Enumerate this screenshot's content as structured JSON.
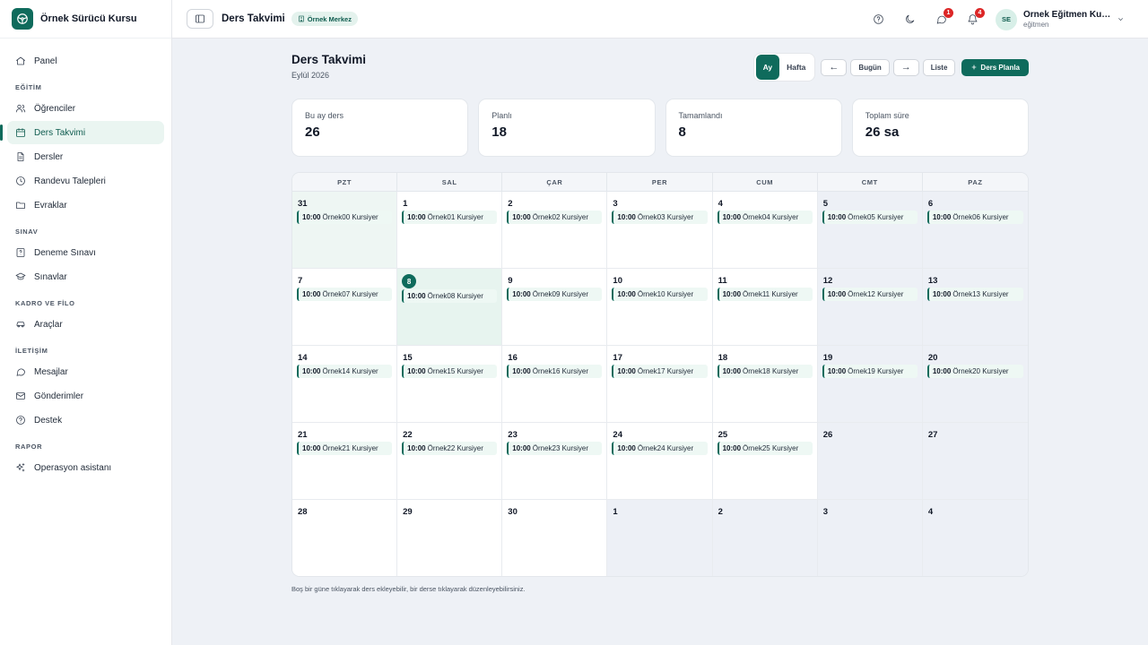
{
  "app": {
    "name": "Örnek Sürücü Kursu"
  },
  "sidebar": {
    "top_item": {
      "label": "Panel",
      "icon": "home-icon"
    },
    "sections": [
      {
        "title": "EĞİTİM",
        "items": [
          {
            "label": "Öğrenciler",
            "icon": "users-icon",
            "active": false
          },
          {
            "label": "Ders Takvimi",
            "icon": "calendar-icon",
            "active": true
          },
          {
            "label": "Dersler",
            "icon": "document-icon",
            "active": false
          },
          {
            "label": "Randevu Talepleri",
            "icon": "clock-icon",
            "active": false
          },
          {
            "label": "Evraklar",
            "icon": "folder-icon",
            "active": false
          }
        ]
      },
      {
        "title": "SINAV",
        "items": [
          {
            "label": "Deneme Sınavı",
            "icon": "quiz-icon",
            "active": false
          },
          {
            "label": "Sınavlar",
            "icon": "graduation-cap-icon",
            "active": false
          }
        ]
      },
      {
        "title": "KADRO VE FİLO",
        "items": [
          {
            "label": "Araçlar",
            "icon": "car-icon",
            "active": false
          }
        ]
      },
      {
        "title": "İLETİŞİM",
        "items": [
          {
            "label": "Mesajlar",
            "icon": "message-icon",
            "active": false
          },
          {
            "label": "Gönderimler",
            "icon": "mail-icon",
            "active": false
          },
          {
            "label": "Destek",
            "icon": "help-icon",
            "active": false
          }
        ]
      },
      {
        "title": "RAPOR",
        "items": [
          {
            "label": "Operasyon asistanı",
            "icon": "sparkles-icon",
            "active": false
          }
        ]
      }
    ]
  },
  "topbar": {
    "title": "Ders Takvimi",
    "branch": "Örnek Merkez",
    "message_badge": "1",
    "notification_badge": "4",
    "user": {
      "initials": "SE",
      "name": "Örnek Eğitmen Kullanıcı",
      "role": "eğitmen"
    }
  },
  "page": {
    "title": "Ders Takvimi",
    "subtitle": "Eylül 2026",
    "view_month": "Ay",
    "view_week": "Hafta",
    "prev": "←",
    "today": "Bugün",
    "next": "→",
    "list": "Liste",
    "add_lesson": "Ders Planla"
  },
  "stats": [
    {
      "label": "Bu ay ders",
      "value": "26"
    },
    {
      "label": "Planlı",
      "value": "18"
    },
    {
      "label": "Tamamlandı",
      "value": "8"
    },
    {
      "label": "Toplam süre",
      "value": "26 sa"
    }
  ],
  "calendar": {
    "weekdays": [
      "PZT",
      "SAL",
      "ÇAR",
      "PER",
      "CUM",
      "CMT",
      "PAZ"
    ],
    "days": [
      {
        "num": "31",
        "outside": true,
        "event": {
          "time": "10:00",
          "text": "Örnek00 Kursiyer"
        }
      },
      {
        "num": "1",
        "event": {
          "time": "10:00",
          "text": "Örnek01 Kursiyer"
        }
      },
      {
        "num": "2",
        "event": {
          "time": "10:00",
          "text": "Örnek02 Kursiyer"
        }
      },
      {
        "num": "3",
        "event": {
          "time": "10:00",
          "text": "Örnek03 Kursiyer"
        }
      },
      {
        "num": "4",
        "event": {
          "time": "10:00",
          "text": "Örnek04 Kursiyer"
        }
      },
      {
        "num": "5",
        "weekend": true,
        "event": {
          "time": "10:00",
          "text": "Örnek05 Kursiyer"
        }
      },
      {
        "num": "6",
        "weekend": true,
        "event": {
          "time": "10:00",
          "text": "Örnek06 Kursiyer"
        }
      },
      {
        "num": "7",
        "event": {
          "time": "10:00",
          "text": "Örnek07 Kursiyer"
        }
      },
      {
        "num": "8",
        "today": true,
        "event": {
          "time": "10:00",
          "text": "Örnek08 Kursiyer"
        }
      },
      {
        "num": "9",
        "event": {
          "time": "10:00",
          "text": "Örnek09 Kursiyer"
        }
      },
      {
        "num": "10",
        "event": {
          "time": "10:00",
          "text": "Örnek10 Kursiyer"
        }
      },
      {
        "num": "11",
        "event": {
          "time": "10:00",
          "text": "Örnek11 Kursiyer"
        }
      },
      {
        "num": "12",
        "weekend": true,
        "event": {
          "time": "10:00",
          "text": "Örnek12 Kursiyer"
        }
      },
      {
        "num": "13",
        "weekend": true,
        "event": {
          "time": "10:00",
          "text": "Örnek13 Kursiyer"
        }
      },
      {
        "num": "14",
        "event": {
          "time": "10:00",
          "text": "Örnek14 Kursiyer"
        }
      },
      {
        "num": "15",
        "event": {
          "time": "10:00",
          "text": "Örnek15 Kursiyer"
        }
      },
      {
        "num": "16",
        "event": {
          "time": "10:00",
          "text": "Örnek16 Kursiyer"
        }
      },
      {
        "num": "17",
        "event": {
          "time": "10:00",
          "text": "Örnek17 Kursiyer"
        }
      },
      {
        "num": "18",
        "event": {
          "time": "10:00",
          "text": "Örnek18 Kursiyer"
        }
      },
      {
        "num": "19",
        "weekend": true,
        "event": {
          "time": "10:00",
          "text": "Örnek19 Kursiyer"
        }
      },
      {
        "num": "20",
        "weekend": true,
        "event": {
          "time": "10:00",
          "text": "Örnek20 Kursiyer"
        }
      },
      {
        "num": "21",
        "event": {
          "time": "10:00",
          "text": "Örnek21 Kursiyer"
        }
      },
      {
        "num": "22",
        "event": {
          "time": "10:00",
          "text": "Örnek22 Kursiyer"
        }
      },
      {
        "num": "23",
        "event": {
          "time": "10:00",
          "text": "Örnek23 Kursiyer"
        }
      },
      {
        "num": "24",
        "event": {
          "time": "10:00",
          "text": "Örnek24 Kursiyer"
        }
      },
      {
        "num": "25",
        "event": {
          "time": "10:00",
          "text": "Örnek25 Kursiyer"
        }
      },
      {
        "num": "26",
        "weekend": true
      },
      {
        "num": "27",
        "weekend": true
      },
      {
        "num": "28"
      },
      {
        "num": "29"
      },
      {
        "num": "30"
      },
      {
        "num": "1",
        "outside": true
      },
      {
        "num": "2",
        "outside": true
      },
      {
        "num": "3",
        "outside": true
      },
      {
        "num": "4",
        "outside": true
      }
    ],
    "hint": "Boş bir güne tıklayarak ders ekleyebilir, bir derse tıklayarak düzenleyebilirsiniz."
  }
}
